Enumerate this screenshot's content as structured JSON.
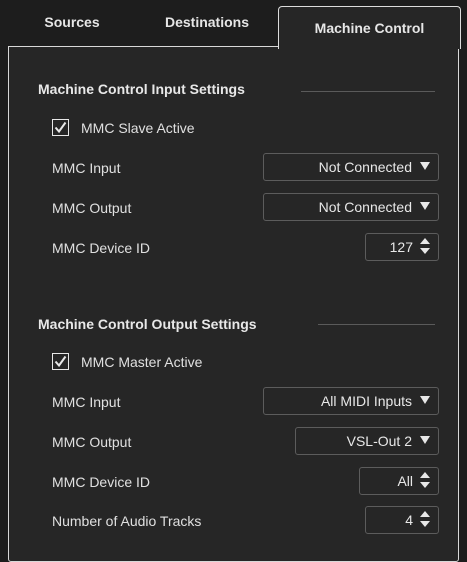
{
  "tabs": [
    {
      "label": "Sources"
    },
    {
      "label": "Destinations"
    },
    {
      "label": "Machine Control",
      "active": true
    }
  ],
  "input_section": {
    "title": "Machine Control Input Settings",
    "checkbox_label": "MMC Slave Active",
    "checked": true,
    "rows": {
      "mmc_input_label": "MMC Input",
      "mmc_input_value": "Not Connected",
      "mmc_output_label": "MMC Output",
      "mmc_output_value": "Not Connected",
      "device_id_label": "MMC Device ID",
      "device_id_value": "127"
    }
  },
  "output_section": {
    "title": "Machine Control Output Settings",
    "checkbox_label": "MMC Master Active",
    "checked": true,
    "rows": {
      "mmc_input_label": "MMC Input",
      "mmc_input_value": "All MIDI Inputs",
      "mmc_output_label": "MMC Output",
      "mmc_output_value": "VSL-Out 2",
      "device_id_label": "MMC Device ID",
      "device_id_value": "All",
      "audio_tracks_label": "Number of Audio Tracks",
      "audio_tracks_value": "4"
    }
  },
  "colors": {
    "background": "#262626",
    "text": "#e4e4e4",
    "border": "#d8d8d8"
  }
}
